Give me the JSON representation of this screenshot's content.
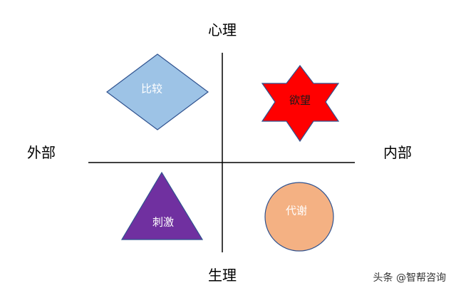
{
  "axes": {
    "top": "心理",
    "bottom": "生理",
    "left": "外部",
    "right": "内部"
  },
  "quadrants": {
    "top_left": {
      "label": "比较",
      "shape": "diamond",
      "fill": "#9dc3e6"
    },
    "top_right": {
      "label": "欲望",
      "shape": "hexagram",
      "fill": "#ff0000"
    },
    "bottom_left": {
      "label": "刺激",
      "shape": "triangle",
      "fill": "#7030a0"
    },
    "bottom_right": {
      "label": "代谢",
      "shape": "circle",
      "fill": "#f4b183"
    }
  },
  "colors": {
    "shape_stroke": "#2f528f",
    "axis_line": "#000000"
  },
  "watermark": "头条 @智帮咨询"
}
